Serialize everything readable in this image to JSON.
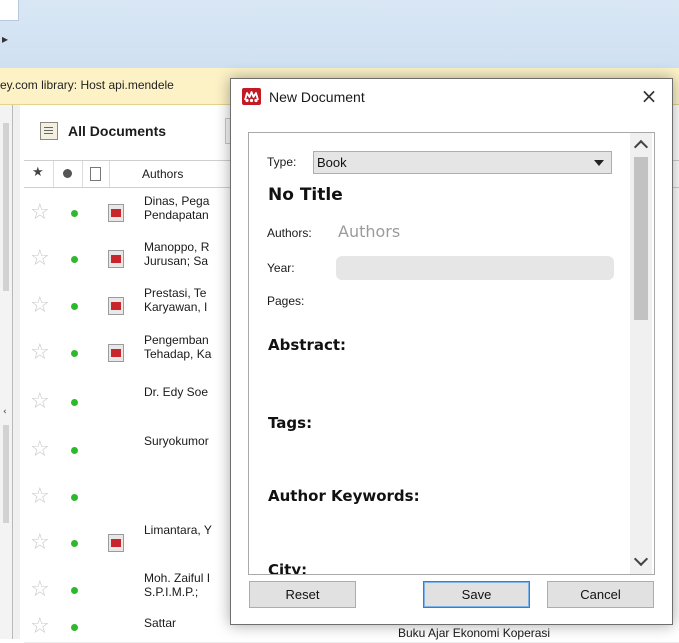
{
  "background": {
    "notice_text": "ey.com library: Host api.mendele",
    "toolbar_title": "All Documents",
    "column_header": "Authors",
    "rows": [
      {
        "author": "Dinas, Pega\nPendapatan",
        "has_pdf": true,
        "title": ""
      },
      {
        "author": "Manoppo, R\nJurusan; Sa",
        "has_pdf": true,
        "title": ""
      },
      {
        "author": "Prestasi, Te\nKaryawan, I",
        "has_pdf": true,
        "title": ""
      },
      {
        "author": "Pengemban\nTehadap, Ka",
        "has_pdf": true,
        "title": ""
      },
      {
        "author": "Dr. Edy Soe",
        "has_pdf": false,
        "title": ""
      },
      {
        "author": "Suryokumor",
        "has_pdf": false,
        "title": ""
      },
      {
        "author": "",
        "has_pdf": false,
        "title": ""
      },
      {
        "author": "Limantara, Y",
        "has_pdf": true,
        "title": ""
      },
      {
        "author": "Moh. Zaiful I\nS.P.I.M.P.;",
        "has_pdf": false,
        "title": ""
      },
      {
        "author": "Sattar",
        "has_pdf": false,
        "title": "Buku Ajar Ekonomi Koperasi"
      }
    ]
  },
  "dialog": {
    "title": "New Document",
    "close_symbol": "×",
    "type_label": "Type:",
    "type_value": "Book",
    "doc_title": "No Title",
    "authors_label": "Authors:",
    "authors_placeholder": "Authors",
    "year_label": "Year:",
    "year_value": "",
    "pages_label": "Pages:",
    "sections": [
      "Abstract:",
      "Tags:",
      "Author Keywords:",
      "City:"
    ],
    "buttons": {
      "reset": "Reset",
      "save": "Save",
      "cancel": "Cancel"
    }
  },
  "colors": {
    "accent_logo": "#c31a23",
    "status_dot": "#2eb82e",
    "notice_bg": "#fdf2c6",
    "primary_button_border": "#3c7fb1"
  }
}
